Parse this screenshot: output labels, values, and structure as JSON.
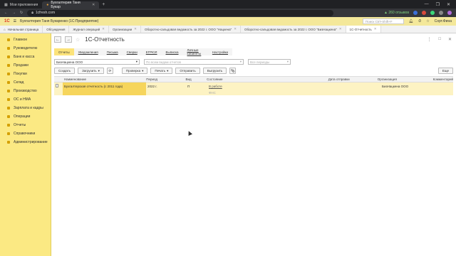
{
  "browser": {
    "tabs": [
      {
        "label": "Мои приложения",
        "active": false
      },
      {
        "label": "Бухгалтерия Таня Букар",
        "active": true
      }
    ],
    "new_tab": "+",
    "window_controls": [
      "—",
      "❐",
      "✕"
    ],
    "url": "1cfresh.com"
  },
  "app": {
    "title": "Бухгалтерия Таня Букаренко (1С:Предприятие)",
    "product": "Бухгалтерия Таня Букаренко  (1С:Предприятие)",
    "logo": "1С",
    "search_placeholder": "Поиск Ctrl+Shift+F",
    "reviews": "▲ 260 отзывов",
    "user": "Сорт.Фина"
  },
  "app_tabs": [
    {
      "label": "Начальная страница",
      "active": false
    },
    {
      "label": "Обсуждения",
      "active": false
    },
    {
      "label": "Журнал операций",
      "active": false
    },
    {
      "label": "Организации",
      "active": false
    },
    {
      "label": "Оборотно-сальдовая ведомость за 2022 г. ООО \"Нацкена\"",
      "active": false
    },
    {
      "label": "Оборотно-сальдовая ведомость за 2022 г. ООО \"БизНацкена\"",
      "active": false
    },
    {
      "label": "1С-Отчетность",
      "active": true
    }
  ],
  "sidebar": {
    "items": [
      {
        "label": "Главное"
      },
      {
        "label": "Руководителю"
      },
      {
        "label": "Банк и касса"
      },
      {
        "label": "Продажи"
      },
      {
        "label": "Покупки"
      },
      {
        "label": "Склад"
      },
      {
        "label": "Производство"
      },
      {
        "label": "ОС и НМА"
      },
      {
        "label": "Зарплата и кадры"
      },
      {
        "label": "Операции"
      },
      {
        "label": "Отчеты"
      },
      {
        "label": "Справочники"
      },
      {
        "label": "Администрирование"
      }
    ]
  },
  "form": {
    "title": "1С-Отчетность",
    "back": "←",
    "forward": "→",
    "favorite": "☆",
    "controls": [
      "⋮",
      "□",
      "✕"
    ],
    "filter_tabs": [
      {
        "label": "Отчеты",
        "active": true
      },
      {
        "label": "Уведомления",
        "active": false
      },
      {
        "label": "Письма",
        "active": false
      },
      {
        "label": "Сверки",
        "active": false
      },
      {
        "label": "ЕГРЮЛ",
        "active": false
      },
      {
        "label": "Выписка",
        "active": false
      },
      {
        "label": "Личные кабинеты",
        "active": false
      },
      {
        "label": "Настройки",
        "active": false
      }
    ],
    "organization": "БизНацкена ООО",
    "kind_placeholder": "По всем видам отчетов",
    "period_placeholder": "Все периоды",
    "toolbar": {
      "create": "Создать",
      "upload": "Загрузить",
      "check": "Проверка",
      "print": "Печать",
      "send": "Отправить",
      "unload": "Выгрузить",
      "more": "Еще"
    },
    "columns": [
      "Наименование",
      "Период",
      "Вид",
      "Состояние",
      "Дата отправки",
      "Организация",
      "Комментарий"
    ],
    "rows": [
      {
        "name": "Бухгалтерская отчетность (с 2011 года)",
        "period": "2022 г.",
        "kind": "П",
        "state": "В работе",
        "state2": "ФНС",
        "sent": "",
        "org": "БизНацкена ООО",
        "comment": ""
      }
    ]
  }
}
